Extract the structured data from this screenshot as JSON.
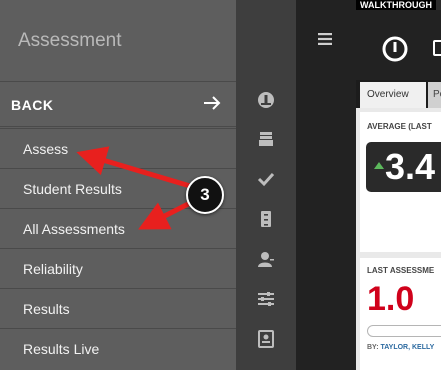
{
  "menu": {
    "title": "Assessment",
    "back_label": "BACK",
    "items": [
      {
        "label": "Assess"
      },
      {
        "label": "Student Results"
      },
      {
        "label": "All Assessments"
      },
      {
        "label": "Reliability"
      },
      {
        "label": "Results"
      },
      {
        "label": "Results Live"
      }
    ]
  },
  "rail_icons": [
    "dashboard-icon",
    "tray-icon",
    "check-icon",
    "cabinet-icon",
    "user-icon",
    "sliders-icon",
    "contact-icon"
  ],
  "app": {
    "walkthrough_label": "WALKTHROUGH",
    "tabs": [
      {
        "label": "Overview"
      },
      {
        "label": "Po"
      }
    ],
    "average_label": "AVERAGE (LAST",
    "average_value": "3.4",
    "last_assessment_label": "LAST ASSESSME",
    "last_assessment_value": "1.0",
    "by_prefix": "BY:",
    "by_name": "TAYLOR, KELLY"
  },
  "annotation": {
    "step_number": "3",
    "arrow_color": "#e8201e"
  },
  "colors": {
    "menu_bg": "#5e5e5e",
    "rail_bg": "#3e3e3e",
    "accent_red": "#d0011b",
    "trend_green": "#5cb85c"
  }
}
